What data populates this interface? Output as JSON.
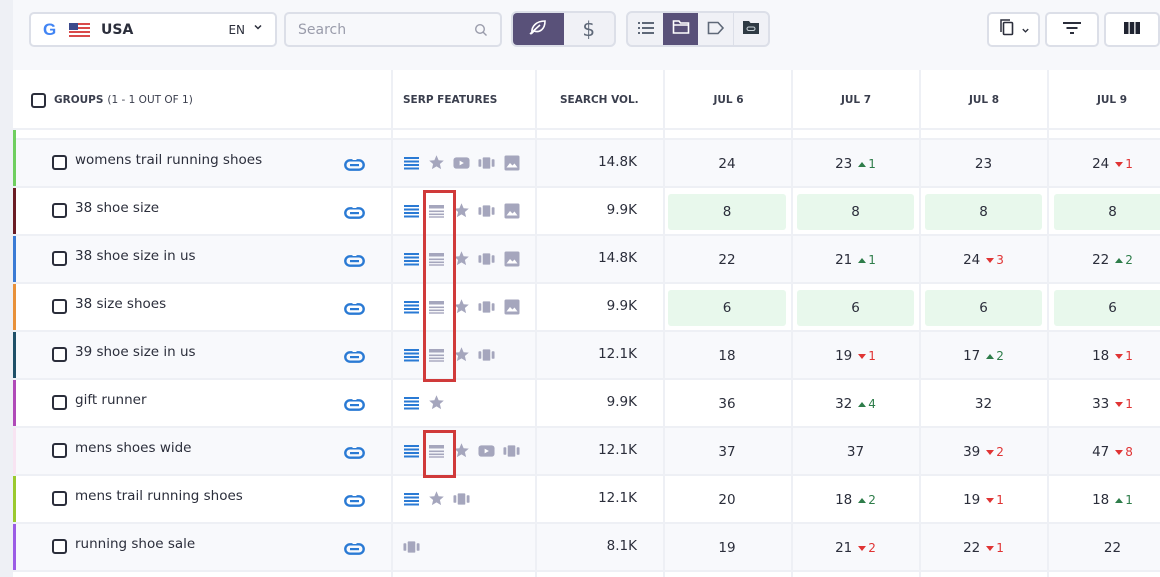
{
  "toolbar": {
    "location": {
      "engine_icon": "google-icon",
      "flag": "us-flag",
      "country": "USA",
      "language": "EN"
    },
    "search": {
      "placeholder": "Search",
      "value": ""
    },
    "mode_toggle": [
      {
        "icon": "leaf-icon",
        "label": "Organic",
        "active": true
      },
      {
        "icon": "dollar-icon",
        "label": "Paid",
        "active": false
      }
    ],
    "view_toggle": [
      {
        "icon": "list-icon",
        "active": false
      },
      {
        "icon": "folder-icon",
        "active": true
      },
      {
        "icon": "tag-icon",
        "active": false
      },
      {
        "icon": "folder-link-icon",
        "active": false
      }
    ],
    "right_buttons": [
      "copy-icon",
      "filter-icon",
      "columns-icon"
    ]
  },
  "table": {
    "headers": {
      "groups": "GROUPS",
      "groups_count": "(1 - 1 OUT OF 1)",
      "serp": "SERP FEATURES",
      "volume": "SEARCH VOL.",
      "dates": [
        "JUL 6",
        "JUL 7",
        "JUL 8",
        "JUL 9"
      ]
    },
    "rows": [
      {
        "keyword": "womens trail running shoes",
        "color": "#6fcf5f",
        "serp": [
          "list",
          "star",
          "video",
          "carousel",
          "image"
        ],
        "volume": "14.8K",
        "positions": [
          {
            "v": "24"
          },
          {
            "v": "23",
            "d": "1",
            "dir": "up"
          },
          {
            "v": "23"
          },
          {
            "v": "24",
            "d": "1",
            "dir": "down"
          }
        ],
        "highlight": false
      },
      {
        "keyword": "38 shoe size",
        "color": "#6b1c24",
        "serp": [
          "list",
          "snippet",
          "star",
          "carousel",
          "image"
        ],
        "volume": "9.9K",
        "positions": [
          {
            "v": "8"
          },
          {
            "v": "8"
          },
          {
            "v": "8"
          },
          {
            "v": "8"
          }
        ],
        "highlight": true
      },
      {
        "keyword": "38 shoe size in us",
        "color": "#3a7bd5",
        "serp": [
          "list",
          "snippet",
          "star",
          "carousel",
          "image"
        ],
        "volume": "14.8K",
        "positions": [
          {
            "v": "22"
          },
          {
            "v": "21",
            "d": "1",
            "dir": "up"
          },
          {
            "v": "24",
            "d": "3",
            "dir": "down"
          },
          {
            "v": "22",
            "d": "2",
            "dir": "up"
          }
        ],
        "highlight": false
      },
      {
        "keyword": "38 size shoes",
        "color": "#e8913a",
        "serp": [
          "list",
          "snippet",
          "star",
          "carousel",
          "image"
        ],
        "volume": "9.9K",
        "positions": [
          {
            "v": "6"
          },
          {
            "v": "6"
          },
          {
            "v": "6"
          },
          {
            "v": "6"
          }
        ],
        "highlight": true
      },
      {
        "keyword": "39 shoe size in us",
        "color": "#1f5068",
        "serp": [
          "list",
          "snippet",
          "star",
          "carousel"
        ],
        "volume": "12.1K",
        "positions": [
          {
            "v": "18"
          },
          {
            "v": "19",
            "d": "1",
            "dir": "down"
          },
          {
            "v": "17",
            "d": "2",
            "dir": "up"
          },
          {
            "v": "18",
            "d": "1",
            "dir": "down"
          }
        ],
        "highlight": false
      },
      {
        "keyword": "gift runner",
        "color": "#b04ab8",
        "serp": [
          "list",
          "star"
        ],
        "volume": "9.9K",
        "positions": [
          {
            "v": "36"
          },
          {
            "v": "32",
            "d": "4",
            "dir": "up"
          },
          {
            "v": "32"
          },
          {
            "v": "33",
            "d": "1",
            "dir": "down"
          }
        ],
        "highlight": false
      },
      {
        "keyword": "mens shoes wide",
        "color": "#f8e4f2",
        "serp": [
          "list",
          "snippet",
          "star",
          "video",
          "carousel"
        ],
        "volume": "12.1K",
        "positions": [
          {
            "v": "37"
          },
          {
            "v": "37"
          },
          {
            "v": "39",
            "d": "2",
            "dir": "down"
          },
          {
            "v": "47",
            "d": "8",
            "dir": "down"
          }
        ],
        "highlight": false
      },
      {
        "keyword": "mens trail running shoes",
        "color": "#9ac92e",
        "serp": [
          "list",
          "star",
          "carousel"
        ],
        "volume": "12.1K",
        "positions": [
          {
            "v": "20"
          },
          {
            "v": "18",
            "d": "2",
            "dir": "up"
          },
          {
            "v": "19",
            "d": "1",
            "dir": "down"
          },
          {
            "v": "18",
            "d": "1",
            "dir": "up"
          }
        ],
        "highlight": false
      },
      {
        "keyword": "running shoe sale",
        "color": "#9b5de5",
        "serp": [
          "carousel"
        ],
        "volume": "8.1K",
        "positions": [
          {
            "v": "19"
          },
          {
            "v": "21",
            "d": "2",
            "dir": "down"
          },
          {
            "v": "22",
            "d": "1",
            "dir": "down"
          },
          {
            "v": "22"
          }
        ],
        "highlight": false
      }
    ]
  },
  "colors": {
    "accent": "#595179",
    "link": "#2a7ad4",
    "up": "#2e7d4a",
    "down": "#e03434",
    "highlight": "#e8f8ec",
    "annotation": "#d03a3a"
  }
}
